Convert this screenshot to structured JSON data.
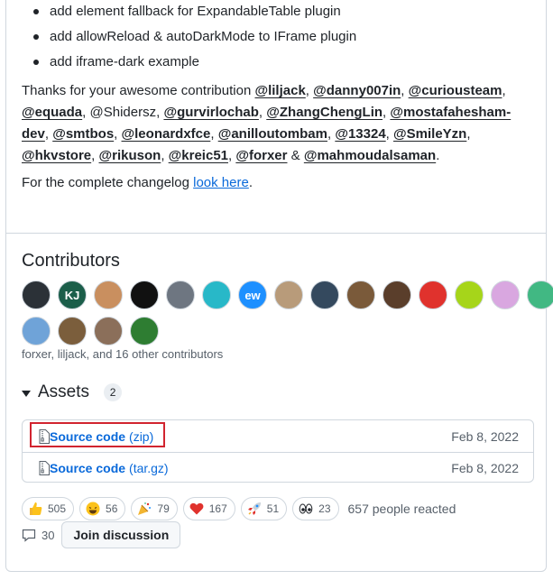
{
  "release_notes": {
    "bullets": [
      "add element fallback for ExpandableTable plugin",
      "add allowReload & autoDarkMode to IFrame plugin",
      "add iframe-dark example"
    ],
    "thanks_prefix": "Thanks for your awesome contribution ",
    "mentions": [
      {
        "text": "@liljack",
        "linked": true
      },
      {
        "text": "@danny007in",
        "linked": true
      },
      {
        "text": "@curiousteam",
        "linked": true
      },
      {
        "text": "@equada",
        "linked": true
      },
      {
        "text": "@Shidersz",
        "linked": false
      },
      {
        "text": "@gurvirlochab",
        "linked": true
      },
      {
        "text": "@ZhangChengLin",
        "linked": true
      },
      {
        "text": "@mostafahesham-dev",
        "linked": true
      },
      {
        "text": "@smtbos",
        "linked": true
      },
      {
        "text": "@leonardxfce",
        "linked": true
      },
      {
        "text": "@anilloutombam",
        "linked": true
      },
      {
        "text": "@13324",
        "linked": true
      },
      {
        "text": "@SmileYzn",
        "linked": true
      },
      {
        "text": "@hkvstore",
        "linked": true
      },
      {
        "text": "@rikuson",
        "linked": true
      },
      {
        "text": "@kreic51",
        "linked": true
      },
      {
        "text": "@forxer",
        "linked": true
      },
      {
        "text": "@mahmoudalsaman",
        "linked": true
      }
    ],
    "changelog_prefix": "For the complete changelog ",
    "changelog_link": "look here",
    "changelog_suffix": "."
  },
  "contributors": {
    "title": "Contributors",
    "avatars": [
      {
        "label": "",
        "color": "#2b3137"
      },
      {
        "label": "KJ",
        "color": "#1b5e4a"
      },
      {
        "label": "",
        "color": "#c98f5f"
      },
      {
        "label": "",
        "color": "#111111"
      },
      {
        "label": "",
        "color": "#6e7681"
      },
      {
        "label": "",
        "color": "#28b8c8"
      },
      {
        "label": "ew",
        "color": "#1e90ff"
      },
      {
        "label": "",
        "color": "#b89b7a"
      },
      {
        "label": "",
        "color": "#34495e"
      },
      {
        "label": "",
        "color": "#7a5a3a"
      },
      {
        "label": "",
        "color": "#5a3e2b"
      },
      {
        "label": "",
        "color": "#e0322d"
      },
      {
        "label": "",
        "color": "#a6d51a"
      },
      {
        "label": "",
        "color": "#d9a7e0"
      },
      {
        "label": "",
        "color": "#41b883"
      },
      {
        "label": "",
        "color": "#6fa3d8"
      },
      {
        "label": "",
        "color": "#7b5e3c"
      },
      {
        "label": "",
        "color": "#8b6f5a"
      },
      {
        "label": "",
        "color": "#2e7d32"
      }
    ],
    "summary": "forxer, liljack, and 16 other contributors"
  },
  "assets": {
    "title": "Assets",
    "count": "2",
    "items": [
      {
        "name": "Source code",
        "ext": "(zip)",
        "date": "Feb 8, 2022"
      },
      {
        "name": "Source code",
        "ext": "(tar.gz)",
        "date": "Feb 8, 2022"
      }
    ]
  },
  "reactions": {
    "items": [
      {
        "icon": "thumbs-up-icon",
        "count": "505"
      },
      {
        "icon": "laugh-icon",
        "count": "56"
      },
      {
        "icon": "tada-icon",
        "count": "79"
      },
      {
        "icon": "heart-icon",
        "count": "167"
      },
      {
        "icon": "rocket-icon",
        "count": "51"
      },
      {
        "icon": "eyes-icon",
        "count": "23"
      }
    ],
    "summary": "657 people reacted"
  },
  "discussion": {
    "comment_count": "30",
    "join_label": "Join discussion"
  },
  "colors": {
    "link": "#0969da",
    "highlight": "#d1242f",
    "border": "#d0d7de"
  }
}
